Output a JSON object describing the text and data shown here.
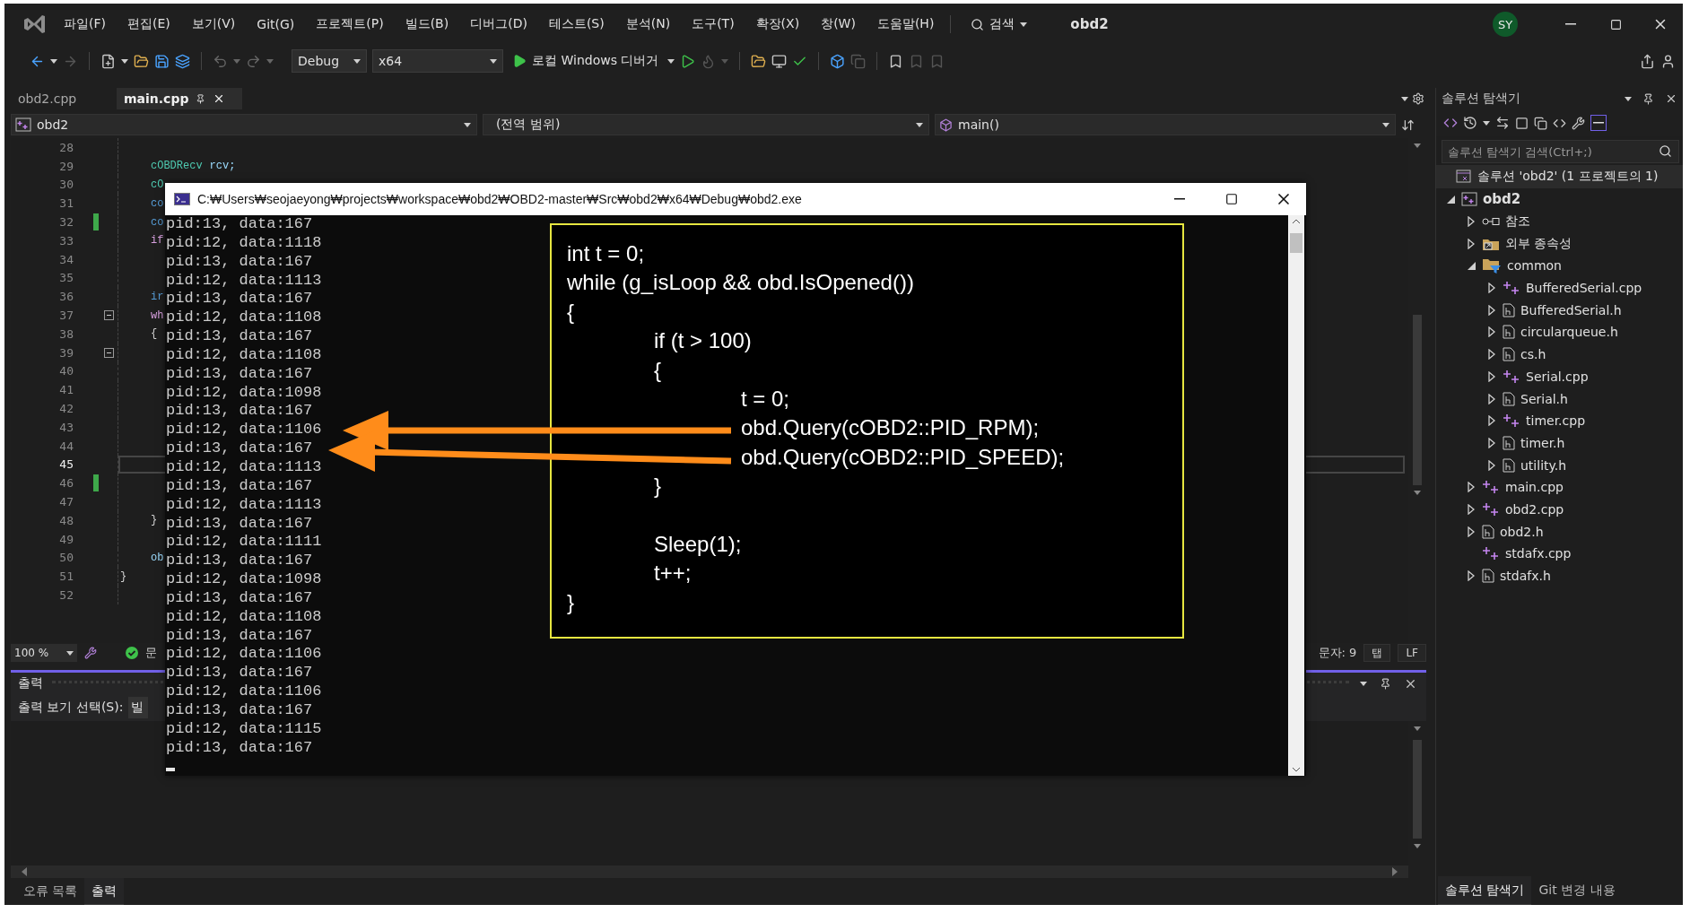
{
  "menu": {
    "items": [
      "파일(F)",
      "편집(E)",
      "보기(V)",
      "Git(G)",
      "프로젝트(P)",
      "빌드(B)",
      "디버그(D)",
      "테스트(S)",
      "분석(N)",
      "도구(T)",
      "확장(X)",
      "창(W)",
      "도움말(H)"
    ],
    "search": "검색",
    "title": "obd2",
    "avatar": "SY"
  },
  "toolbar": {
    "configuration": "Debug",
    "platform": "x64",
    "debugger": "로컬 Windows 디버거"
  },
  "editor_tabs": [
    {
      "label": "obd2.cpp",
      "selected": false
    },
    {
      "label": "main.cpp",
      "selected": true
    }
  ],
  "nav_bar": {
    "project": "obd2",
    "scope": "(전역 범위)",
    "member": "main()"
  },
  "editor": {
    "lines": [
      {
        "number": "28",
        "changed": false,
        "current": false,
        "fold": false
      },
      {
        "number": "29",
        "changed": false,
        "current": false,
        "fold": false,
        "tokens": [
          {
            "text": "cOBDRecv",
            "kind": "type"
          },
          {
            "text": "rcv;",
            "kind": "variable"
          }
        ]
      },
      {
        "number": "30",
        "changed": false,
        "current": false,
        "fold": false,
        "tokens": [
          {
            "text": "cO",
            "kind": "type"
          }
        ]
      },
      {
        "number": "31",
        "changed": false,
        "current": false,
        "fold": false,
        "tokens": [
          {
            "text": "co",
            "kind": "keyword"
          }
        ]
      },
      {
        "number": "32",
        "changed": true,
        "current": false,
        "fold": false,
        "tokens": [
          {
            "text": "co",
            "kind": "keyword"
          }
        ]
      },
      {
        "number": "33",
        "changed": false,
        "current": false,
        "fold": false,
        "tokens": [
          {
            "text": "if",
            "kind": "control"
          }
        ]
      },
      {
        "number": "34",
        "changed": false,
        "current": false,
        "fold": false
      },
      {
        "number": "35",
        "changed": false,
        "current": false,
        "fold": false
      },
      {
        "number": "36",
        "changed": false,
        "current": false,
        "fold": false,
        "tokens": [
          {
            "text": "ir",
            "kind": "keyword"
          }
        ]
      },
      {
        "number": "37",
        "changed": false,
        "current": false,
        "fold": true,
        "tokens": [
          {
            "text": "wh",
            "kind": "control"
          }
        ]
      },
      {
        "number": "38",
        "changed": false,
        "current": false,
        "fold": false,
        "tokens": [
          {
            "text": "{",
            "kind": "punct"
          }
        ]
      },
      {
        "number": "39",
        "changed": false,
        "current": false,
        "fold": true
      },
      {
        "number": "40",
        "changed": false,
        "current": false,
        "fold": false
      },
      {
        "number": "41",
        "changed": false,
        "current": false,
        "fold": false
      },
      {
        "number": "42",
        "changed": false,
        "current": false,
        "fold": false
      },
      {
        "number": "43",
        "changed": false,
        "current": false,
        "fold": false
      },
      {
        "number": "44",
        "changed": false,
        "current": false,
        "fold": false
      },
      {
        "number": "45",
        "changed": false,
        "current": true,
        "fold": false
      },
      {
        "number": "46",
        "changed": true,
        "current": false,
        "fold": false
      },
      {
        "number": "47",
        "changed": false,
        "current": false,
        "fold": false
      },
      {
        "number": "48",
        "changed": false,
        "current": false,
        "fold": false,
        "tokens": [
          {
            "text": "}",
            "kind": "punct"
          }
        ]
      },
      {
        "number": "49",
        "changed": false,
        "current": false,
        "fold": false
      },
      {
        "number": "50",
        "changed": false,
        "current": false,
        "fold": false,
        "tokens": [
          {
            "text": "ob",
            "kind": "variable"
          }
        ]
      },
      {
        "number": "51",
        "changed": false,
        "current": false,
        "fold": false,
        "tokens": [
          {
            "text": "}",
            "kind": "outer_brace"
          }
        ]
      },
      {
        "number": "52",
        "changed": false,
        "current": false,
        "fold": false
      }
    ]
  },
  "status_bar": {
    "zoom": "100 %",
    "fragment": "문",
    "column": "문자: 9",
    "indent": "탭",
    "line_ending": "LF"
  },
  "output": {
    "title": "출력",
    "source_label": "출력 보기 선택(S):",
    "source_value": "빌"
  },
  "bottom_tabs": [
    {
      "label": "오류 목록",
      "selected": false
    },
    {
      "label": "출력",
      "selected": true
    }
  ],
  "solution_explorer": {
    "title": "솔루션 탐색기",
    "search": {
      "placeholder": "솔루션 탐색기 검색(Ctrl+;)"
    },
    "solution": "솔루션 'obd2' (1 프로젝트의 1)",
    "tree": [
      {
        "label": "obd2",
        "kind": "project",
        "expanded": true,
        "children": [
          {
            "label": "참조",
            "kind": "references",
            "expanded": false
          },
          {
            "label": "외부 종속성",
            "kind": "external",
            "expanded": false
          },
          {
            "label": "common",
            "kind": "filter",
            "expanded": true,
            "children": [
              {
                "label": "BufferedSerial.cpp",
                "kind": "cpp",
                "expanded": false
              },
              {
                "label": "BufferedSerial.h",
                "kind": "h",
                "expanded": false
              },
              {
                "label": "circularqueue.h",
                "kind": "h",
                "expanded": false
              },
              {
                "label": "cs.h",
                "kind": "h",
                "expanded": false
              },
              {
                "label": "Serial.cpp",
                "kind": "cpp",
                "expanded": false
              },
              {
                "label": "Serial.h",
                "kind": "h",
                "expanded": false
              },
              {
                "label": "timer.cpp",
                "kind": "cpp",
                "expanded": false
              },
              {
                "label": "timer.h",
                "kind": "h",
                "expanded": false
              },
              {
                "label": "utility.h",
                "kind": "h",
                "expanded": false
              }
            ]
          },
          {
            "label": "main.cpp",
            "kind": "cpp",
            "expanded": false
          },
          {
            "label": "obd2.cpp",
            "kind": "cpp",
            "expanded": false
          },
          {
            "label": "obd2.h",
            "kind": "h",
            "expanded": false
          },
          {
            "label": "stdafx.cpp",
            "kind": "cpp"
          },
          {
            "label": "stdafx.h",
            "kind": "h",
            "expanded": false
          }
        ]
      }
    ]
  },
  "side_tabs": [
    {
      "label": "솔루션 탐색기",
      "selected": true
    },
    {
      "label": "Git 변경 내용",
      "selected": false
    }
  ],
  "console": {
    "title": "C:₩Users₩seojaeyong₩projects₩workspace₩obd2₩OBD2-master₩Src₩obd2₩x64₩Debug₩obd2.exe",
    "lines": [
      "pid:13, data:167",
      "pid:12, data:1118",
      "pid:13, data:167",
      "pid:12, data:1113",
      "pid:13, data:167",
      "pid:12, data:1108",
      "pid:13, data:167",
      "pid:12, data:1108",
      "pid:13, data:167",
      "pid:12, data:1098",
      "pid:13, data:167",
      "pid:12, data:1106",
      "pid:13, data:167",
      "pid:12, data:1113",
      "pid:13, data:167",
      "pid:12, data:1113",
      "pid:13, data:167",
      "pid:12, data:1111",
      "pid:13, data:167",
      "pid:12, data:1098",
      "pid:13, data:167",
      "pid:12, data:1108",
      "pid:13, data:167",
      "pid:12, data:1106",
      "pid:13, data:167",
      "pid:12, data:1106",
      "pid:13, data:167",
      "pid:12, data:1115",
      "pid:13, data:167"
    ]
  },
  "annotation": {
    "lines": [
      {
        "text": "int t = 0;"
      },
      {
        "text": "while (g_isLoop && obd.IsOpened())"
      },
      {
        "text": "{",
        "close": "}",
        "children": [
          {
            "text": "if (t > 100)"
          },
          {
            "text": "{",
            "close": "}",
            "children": [
              {
                "text": "t = 0;"
              },
              {
                "text": "obd.Query(cOBD2::PID_RPM);"
              },
              {
                "text": "obd.Query(cOBD2::PID_SPEED);"
              }
            ]
          },
          {
            "text": "Sleep(1);",
            "gap_before": true
          },
          {
            "text": "t++;"
          }
        ]
      }
    ]
  }
}
